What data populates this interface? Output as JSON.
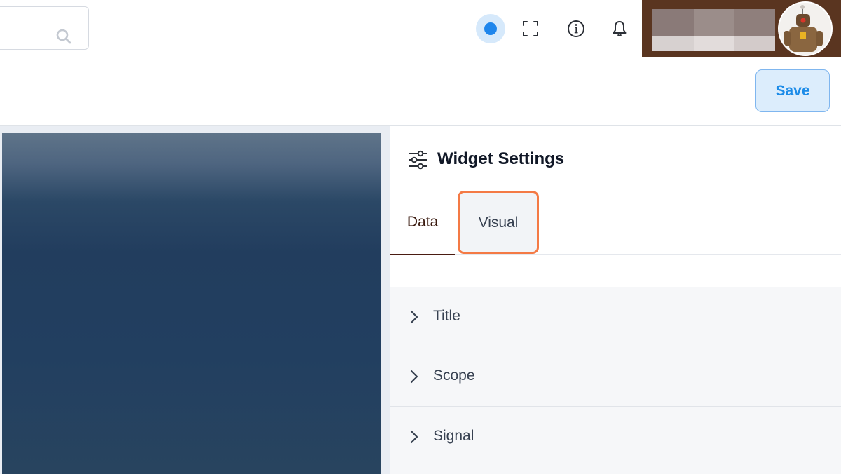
{
  "header": {
    "search": {
      "placeholder": "",
      "value": ""
    },
    "icons": [
      "search-icon",
      "status-dot-icon",
      "fullscreen-icon",
      "info-icon",
      "bell-icon"
    ],
    "status_color": "#1f86ec"
  },
  "toolbar": {
    "save_label": "Save"
  },
  "settings_panel": {
    "title": "Widget Settings",
    "icon": "sliders-icon",
    "tabs": [
      {
        "label": "Data",
        "active": true
      },
      {
        "label": "Visual",
        "highlighted": true
      }
    ],
    "sections": [
      {
        "label": "Title",
        "expanded": false
      },
      {
        "label": "Scope",
        "expanded": false
      },
      {
        "label": "Signal",
        "expanded": false
      }
    ]
  },
  "colors": {
    "accent": "#1d8ce8",
    "active_tab_underline": "#4a1c12",
    "highlight_outline": "#f47a45",
    "preview_background": "#223d5e"
  }
}
